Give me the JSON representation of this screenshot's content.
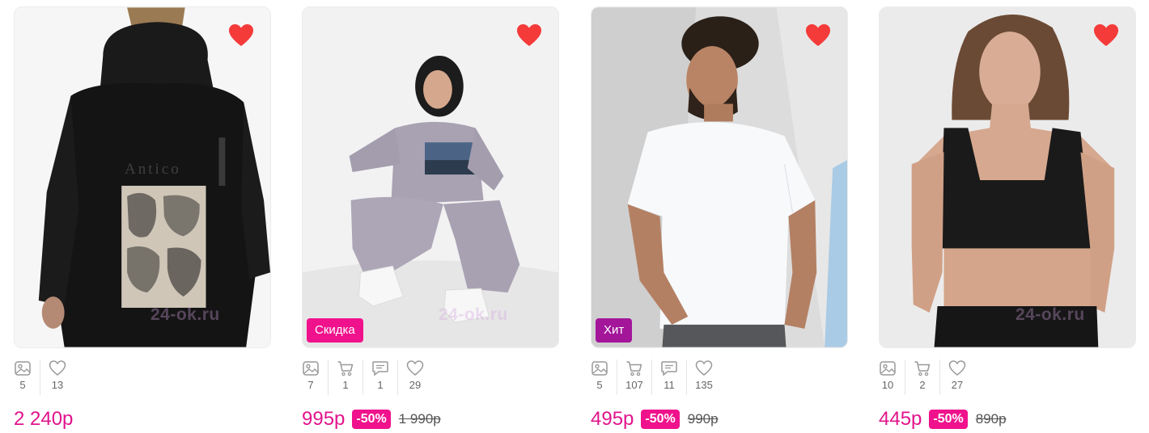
{
  "colors": {
    "accent": "#e1148c",
    "heart": "#f53a3a",
    "badge_sale": "#f0128c",
    "badge_hit": "#a3169a"
  },
  "products": [
    {
      "badge": "",
      "watermark": "24-ok.ru",
      "print_text": "Antico",
      "stats": {
        "photos": "5",
        "likes": "13"
      },
      "price": "2 240р",
      "discount": "",
      "old_price": ""
    },
    {
      "badge": "Скидка",
      "watermark": "24-ok.ru",
      "stats": {
        "photos": "7",
        "cart": "1",
        "comments": "1",
        "likes": "29"
      },
      "price": "995р",
      "discount": "-50%",
      "old_price": "1 990р"
    },
    {
      "badge": "Хит",
      "watermark": "",
      "stats": {
        "photos": "5",
        "cart": "107",
        "comments": "11",
        "likes": "135"
      },
      "price": "495р",
      "discount": "-50%",
      "old_price": "990р"
    },
    {
      "badge": "",
      "watermark": "24-ok.ru",
      "stats": {
        "photos": "10",
        "cart": "2",
        "likes": "27"
      },
      "price": "445р",
      "discount": "-50%",
      "old_price": "890р"
    }
  ]
}
